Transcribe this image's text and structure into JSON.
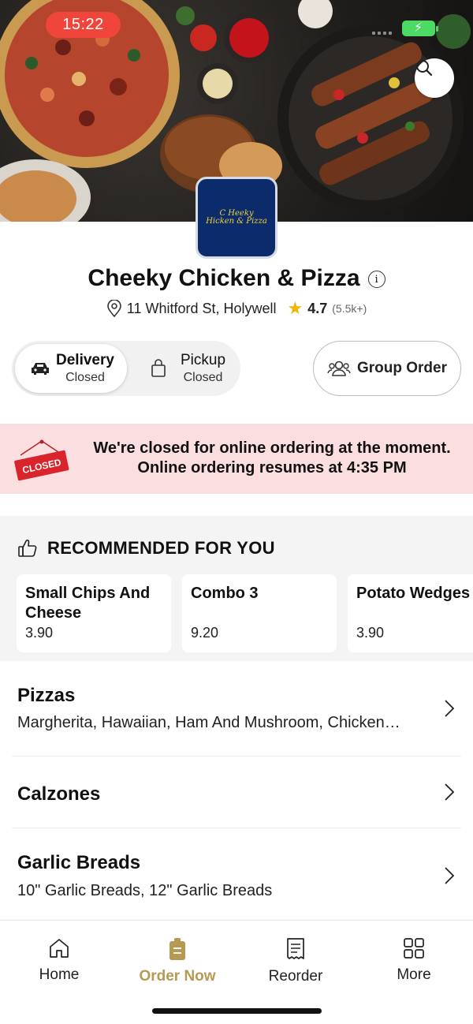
{
  "status_bar": {
    "time": "15:22"
  },
  "restaurant": {
    "logo_text_line1": "C Heeky",
    "logo_text_line2": "Hicken & Pizza",
    "name": "Cheeky Chicken & Pizza",
    "address": "11 Whitford St, Holywell",
    "rating": "4.7",
    "rating_count": "(5.5k+)"
  },
  "order_mode": {
    "delivery": {
      "label": "Delivery",
      "status": "Closed"
    },
    "pickup": {
      "label": "Pickup",
      "status": "Closed"
    },
    "group_order_label": "Group Order"
  },
  "closed_notice": {
    "sign_text": "CLOSED",
    "line1": "We're closed for online ordering at the moment.",
    "line2": "Online ordering resumes at 4:35 PM"
  },
  "recommended": {
    "title": "RECOMMENDED FOR YOU",
    "items": [
      {
        "name": "Small Chips And Cheese",
        "price": "3.90"
      },
      {
        "name": "Combo 3",
        "price": "9.20"
      },
      {
        "name": "Potato Wedges",
        "price": "3.90"
      }
    ]
  },
  "categories": [
    {
      "name": "Pizzas",
      "subtitle": "Margherita, Hawaiian, Ham And Mushroom, Chicken…"
    },
    {
      "name": "Calzones",
      "subtitle": ""
    },
    {
      "name": "Garlic Breads",
      "subtitle": "10\" Garlic Breads, 12\" Garlic Breads"
    }
  ],
  "tabbar": {
    "home": "Home",
    "order_now": "Order Now",
    "reorder": "Reorder",
    "more": "More",
    "accent_color": "#b69a54"
  },
  "icons": [
    "search-icon",
    "info-icon",
    "location-pin-icon",
    "star-icon",
    "car-icon",
    "shopping-bag-icon",
    "group-icon",
    "closed-sign-icon",
    "thumbs-up-icon",
    "chevron-right-icon",
    "home-icon",
    "order-bag-icon",
    "receipt-icon",
    "grid-icon"
  ]
}
